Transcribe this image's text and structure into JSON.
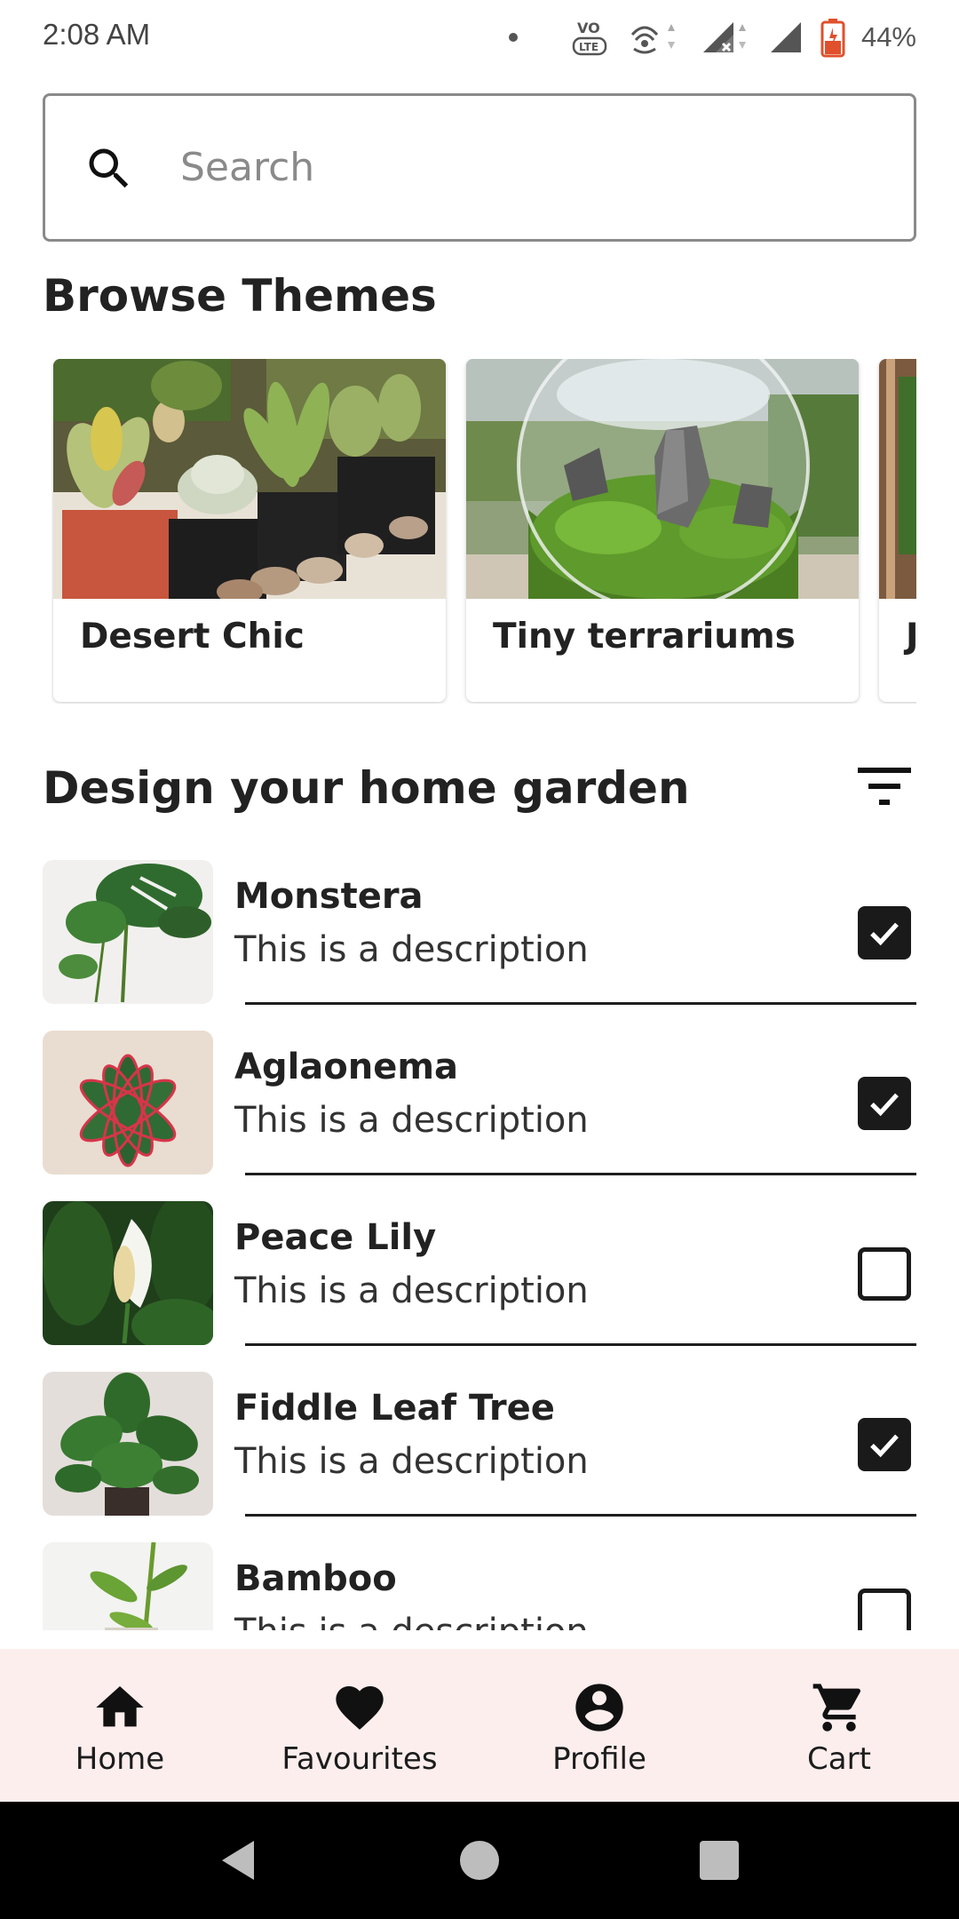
{
  "status_bar": {
    "time": "2:08 AM",
    "battery_percent": "44%",
    "battery_level": 0.44,
    "icons": [
      "dot-icon",
      "volte-icon",
      "hotspot-icon",
      "signal-no-data-icon",
      "signal-icon",
      "battery-icon"
    ]
  },
  "search": {
    "placeholder": "Search",
    "value": ""
  },
  "browse_themes": {
    "title": "Browse Themes",
    "cards": [
      {
        "label": "Desert Chic",
        "image": "succulents-photo"
      },
      {
        "label": "Tiny terrariums",
        "image": "terrarium-globe-photo"
      },
      {
        "label": "J",
        "image": "partially-visible-photo"
      }
    ]
  },
  "garden": {
    "title": "Design your home garden",
    "filter_icon": "filter-list-icon",
    "plants": [
      {
        "name": "Monstera",
        "description": "This is a description",
        "checked": true
      },
      {
        "name": "Aglaonema",
        "description": "This is a description",
        "checked": true
      },
      {
        "name": "Peace Lily",
        "description": "This is a description",
        "checked": false
      },
      {
        "name": "Fiddle Leaf Tree",
        "description": "This is a description",
        "checked": true
      },
      {
        "name": "Bamboo",
        "description": "This is a description",
        "checked": false
      }
    ]
  },
  "bottom_nav": {
    "items": [
      {
        "label": "Home",
        "icon": "home-icon"
      },
      {
        "label": "Favourites",
        "icon": "heart-icon"
      },
      {
        "label": "Profile",
        "icon": "account-circle-icon"
      },
      {
        "label": "Cart",
        "icon": "cart-icon"
      }
    ]
  },
  "system_nav": {
    "buttons": [
      "back-icon",
      "home-circle-icon",
      "recents-icon"
    ]
  },
  "colors": {
    "bottom_nav_bg": "#fdeeee",
    "checkbox": "#1a1a1a",
    "text": "#222222"
  }
}
